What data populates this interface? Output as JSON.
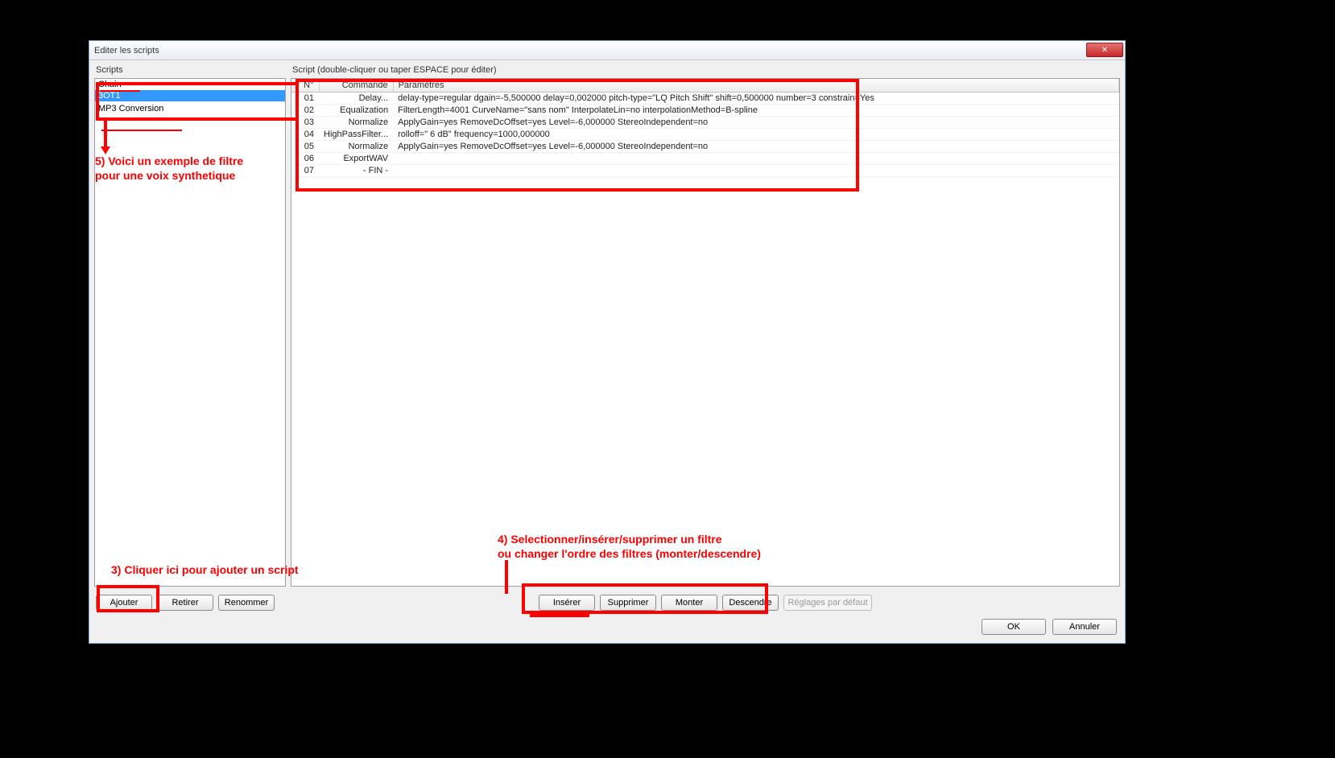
{
  "window": {
    "title": "Editer les scripts",
    "close_glyph": "✕"
  },
  "left_panel": {
    "label": "Scripts",
    "items": [
      {
        "label": "Chain",
        "selected": false
      },
      {
        "label": "3OT1",
        "selected": true
      },
      {
        "label": "",
        "selected": false
      },
      {
        "label": "MP3 Conversion",
        "selected": false
      }
    ],
    "buttons": {
      "add": "Ajouter",
      "remove": "Retirer",
      "rename": "Renommer"
    }
  },
  "right_panel": {
    "label": "Script  (double-cliquer ou taper ESPACE pour éditer)",
    "columns": {
      "no": "N°",
      "command": "Commande",
      "params": "Paramètres"
    },
    "rows": [
      {
        "no": "01",
        "cmd": "Delay...",
        "params": "delay-type=regular dgain=-5,500000 delay=0,002000 pitch-type=\"LQ Pitch Shift\" shift=0,500000 number=3 constrain=Yes"
      },
      {
        "no": "02",
        "cmd": "Equalization",
        "params": "FilterLength=4001 CurveName=\"sans nom\" InterpolateLin=no interpolationMethod=B-spline"
      },
      {
        "no": "03",
        "cmd": "Normalize",
        "params": "ApplyGain=yes RemoveDcOffset=yes Level=-6,000000 StereoIndependent=no"
      },
      {
        "no": "04",
        "cmd": "HighPassFilter...",
        "params": "rolloff=\"  6 dB\" frequency=1000,000000"
      },
      {
        "no": "05",
        "cmd": "Normalize",
        "params": "ApplyGain=yes RemoveDcOffset=yes Level=-6,000000 StereoIndependent=no"
      },
      {
        "no": "06",
        "cmd": "ExportWAV",
        "params": ""
      },
      {
        "no": "07",
        "cmd": "- FIN -",
        "params": ""
      }
    ],
    "buttons": {
      "insert": "Insérer",
      "delete": "Supprimer",
      "up": "Monter",
      "down": "Descendre",
      "defaults": "Réglages par défaut"
    }
  },
  "footer": {
    "ok": "OK",
    "cancel": "Annuler"
  },
  "annotations": {
    "note3": "3) Cliquer ici pour ajouter un script",
    "note4_line1": "4) Selectionner/insérer/supprimer un filtre",
    "note4_line2": "    ou  changer l'ordre des filtres (monter/descendre)",
    "note5_line1": "5) Voici un exemple de filtre",
    "note5_line2": "pour une voix synthetique"
  }
}
